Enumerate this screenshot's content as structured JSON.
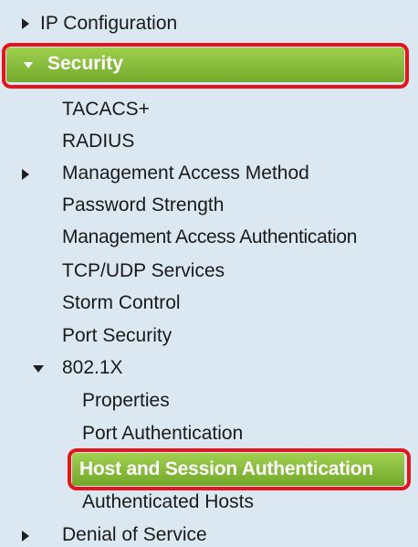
{
  "nav": {
    "ip_configuration": "IP Configuration",
    "security": "Security",
    "security_children": {
      "tacacs": "TACACS+",
      "radius": "RADIUS",
      "management_access_method": "Management Access Method",
      "password_strength": "Password Strength",
      "management_access_authentication": "Management Access Authentication",
      "tcp_udp_services": "TCP/UDP Services",
      "storm_control": "Storm Control",
      "port_security": "Port Security",
      "dot1x": "802.1X"
    },
    "dot1x_children": {
      "properties": "Properties",
      "port_authentication": "Port Authentication",
      "host_and_session_authentication": "Host and Session Authentication",
      "authenticated_hosts": "Authenticated Hosts"
    },
    "denial_of_service": "Denial of Service"
  },
  "colors": {
    "background": "#dbe8f1",
    "selected_green": "#8bc23f",
    "highlight_red": "#e8121c"
  }
}
